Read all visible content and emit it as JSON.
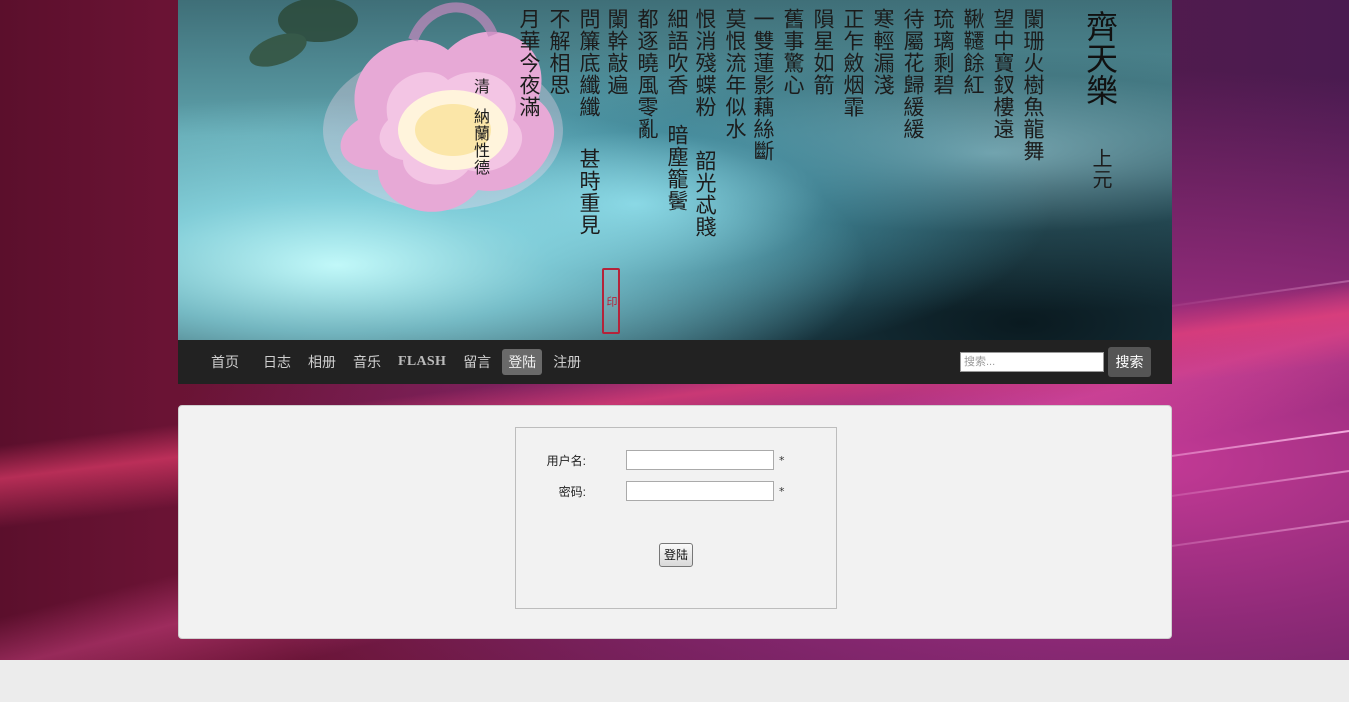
{
  "banner": {
    "title": "齊天樂",
    "subtitle": "上元",
    "poem_columns": [
      "闌珊火樹魚龍舞",
      "望中寶釵樓遠",
      "鞦韆餘紅",
      "琉璃剩碧",
      "待屬花歸緩緩",
      "寒輕漏淺",
      "正乍斂烟霏",
      "隕星如箭",
      "舊事驚心",
      "一雙蓮影藕絲斷",
      "莫恨流年似水",
      "恨消殘蝶粉",
      "細語吹香",
      "都逐曉風零亂",
      "闌幹敲遍",
      "問簾底纖纖",
      "不解相思",
      "月華今夜滿"
    ],
    "lower_columns": [
      "韶光忒賤",
      "暗塵籠鬢",
      "甚時重見"
    ],
    "author_dynasty": "清",
    "author_name": "納蘭性德"
  },
  "nav": {
    "items": [
      {
        "label": "首页"
      },
      {
        "label": "日志"
      },
      {
        "label": "相册"
      },
      {
        "label": "音乐"
      },
      {
        "label": "FLASH"
      },
      {
        "label": "留言"
      },
      {
        "label": "登陆"
      },
      {
        "label": "注册"
      }
    ],
    "active_index": 6,
    "search_placeholder": "搜索...",
    "search_button": "搜索"
  },
  "login_form": {
    "username_label": "用户名:",
    "password_label": "密码:",
    "required_mark": "*",
    "submit_label": "登陆"
  }
}
